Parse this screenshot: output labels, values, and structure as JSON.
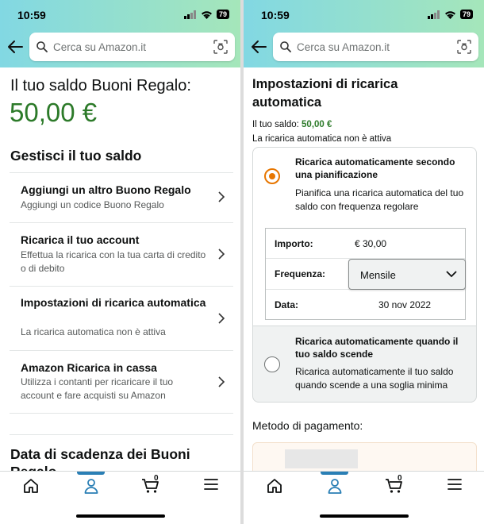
{
  "status_bar": {
    "time": "10:59",
    "battery": "79"
  },
  "search": {
    "placeholder": "Cerca su Amazon.it"
  },
  "left": {
    "balance_label": "Il tuo saldo Buoni Regalo:",
    "balance_amount": "50,00 €",
    "manage_title": "Gestisci il tuo saldo",
    "menu": [
      {
        "title": "Aggiungi un altro Buono Regalo",
        "subtitle": "Aggiungi un codice Buono Regalo"
      },
      {
        "title": "Ricarica il tuo account",
        "subtitle": "Effettua la ricarica con la tua carta di credito o di debito"
      },
      {
        "title": "Impostazioni di ricarica automatica",
        "subtitle": "La ricarica automatica non è attiva"
      },
      {
        "title": "Amazon Ricarica in cassa",
        "subtitle": "Utilizza i contanti per ricaricare il tuo account e fare acquisti su Amazon"
      }
    ],
    "expiry_title": "Data di scadenza dei Buoni Regalo"
  },
  "right": {
    "title": "Impostazioni di ricarica automatica",
    "saldo_label": "Il tuo saldo:",
    "saldo_value": "50,00 €",
    "inactive_text": "La ricarica automatica non è attiva",
    "option_scheduled": {
      "title": "Ricarica automaticamente secondo una pianificazione",
      "description": "Pianifica una ricarica automatica del tuo saldo con frequenza regolare",
      "selected": true
    },
    "details": {
      "amount_label": "Importo:",
      "amount_value": "€ 30,00",
      "frequency_label": "Frequenza:",
      "frequency_value": "Mensile",
      "date_label": "Data:",
      "date_value": "30 nov 2022"
    },
    "option_low_balance": {
      "title": "Ricarica automaticamente quando il tuo saldo scende",
      "description": "Ricarica automaticamente il tuo saldo quando scende a una soglia minima",
      "selected": false
    },
    "payment_label": "Metodo di pagamento:"
  },
  "bottom_nav": {
    "items": [
      "home-icon",
      "account-icon",
      "cart-icon",
      "menu-icon"
    ],
    "cart_count": "0",
    "active": "account-icon"
  },
  "colors": {
    "accent_green": "#2c7a29",
    "radio_orange": "#e77600",
    "nav_blue": "#2a7fb5"
  }
}
